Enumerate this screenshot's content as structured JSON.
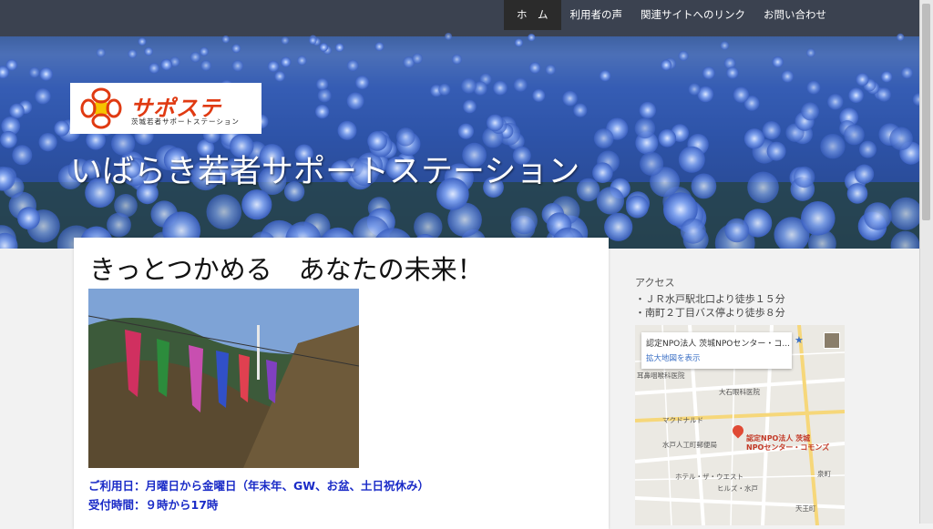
{
  "nav": {
    "items": [
      {
        "label": "ホ　ム",
        "active": true
      },
      {
        "label": "利用者の声",
        "active": false
      },
      {
        "label": "関連サイトへのリンク",
        "active": false
      },
      {
        "label": "お問い合わせ",
        "active": false
      }
    ]
  },
  "header": {
    "logo_text": "サポステ",
    "logo_subtext": "茨城若者サポートステーション",
    "site_title": "いばらき若者サポートステーション"
  },
  "main": {
    "headline": "きっとつかめる　あなたの未来！",
    "hours_days": "ご利用日：月曜日から金曜日（年末年、GW、お盆、土日祝休み）",
    "hours_time": "受付時間：９時から17時"
  },
  "sidebar": {
    "access_title": "アクセス",
    "access_lines": [
      "・ＪＲ水戸駅北口より徒歩１５分",
      "・南町２丁目バス停より徒歩８分"
    ]
  },
  "map": {
    "place_name": "認定NPO法人 茨城NPOセンター・コ...",
    "enlarge_link": "拡大地図を表示",
    "pin_label_line1": "認定NPO法人 茨城",
    "pin_label_line2": "NPOセンター・コモンズ",
    "labels": [
      "耳鼻咽喉科医院",
      "大石眼科医院",
      "マクドナルド",
      "水戸人工町郵便局",
      "ホテル・ザ・ウエスト",
      "ヒルズ・水戸",
      "泉町",
      "天王町"
    ]
  },
  "colors": {
    "accent_blue": "#1a2bc7",
    "nav_active_bg": "#2b2b2b",
    "logo_red": "#e03a12"
  }
}
